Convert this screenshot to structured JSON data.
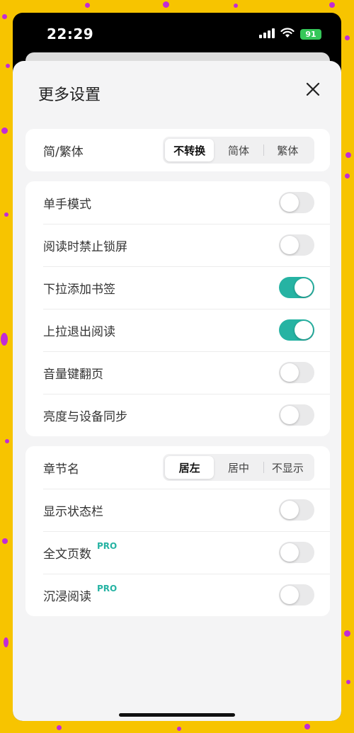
{
  "status_bar": {
    "time": "22:29",
    "battery": "91"
  },
  "sheet": {
    "title": "更多设置"
  },
  "script_section": {
    "label": "简/繁体",
    "options": [
      "不转换",
      "简体",
      "繁体"
    ],
    "selected": "不转换"
  },
  "reading_section": {
    "items": [
      {
        "label": "单手模式",
        "on": false
      },
      {
        "label": "阅读时禁止锁屏",
        "on": false
      },
      {
        "label": "下拉添加书签",
        "on": true
      },
      {
        "label": "上拉退出阅读",
        "on": true
      },
      {
        "label": "音量键翻页",
        "on": false
      },
      {
        "label": "亮度与设备同步",
        "on": false
      }
    ]
  },
  "chapter_section": {
    "label": "章节名",
    "options": [
      "居左",
      "居中",
      "不显示"
    ],
    "selected": "居左",
    "items": [
      {
        "label": "显示状态栏",
        "on": false,
        "badge": ""
      },
      {
        "label": "全文页数",
        "on": false,
        "badge": "PRO"
      },
      {
        "label": "沉浸阅读",
        "on": false,
        "badge": "PRO"
      }
    ]
  },
  "colors": {
    "accent": "#26b3a3",
    "background_yellow": "#f7c400",
    "confetti": "#c22bd6"
  }
}
